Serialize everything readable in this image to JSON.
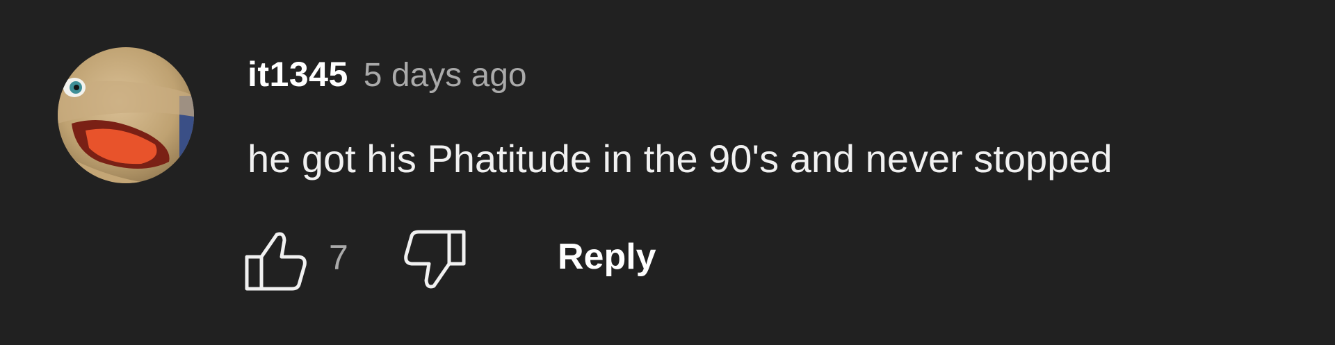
{
  "comment": {
    "author": "it1345",
    "timestamp": "5 days ago",
    "text": "he got his Phatitude in the 90's and never stopped",
    "like_count": "7",
    "reply_label": "Reply",
    "avatar": "avatar-image"
  },
  "icons": {
    "like": "thumbs-up-icon",
    "dislike": "thumbs-down-icon"
  },
  "colors": {
    "background": "#212121",
    "author": "#ffffff",
    "meta": "#aaaaaa",
    "text": "#f1f1f1"
  }
}
